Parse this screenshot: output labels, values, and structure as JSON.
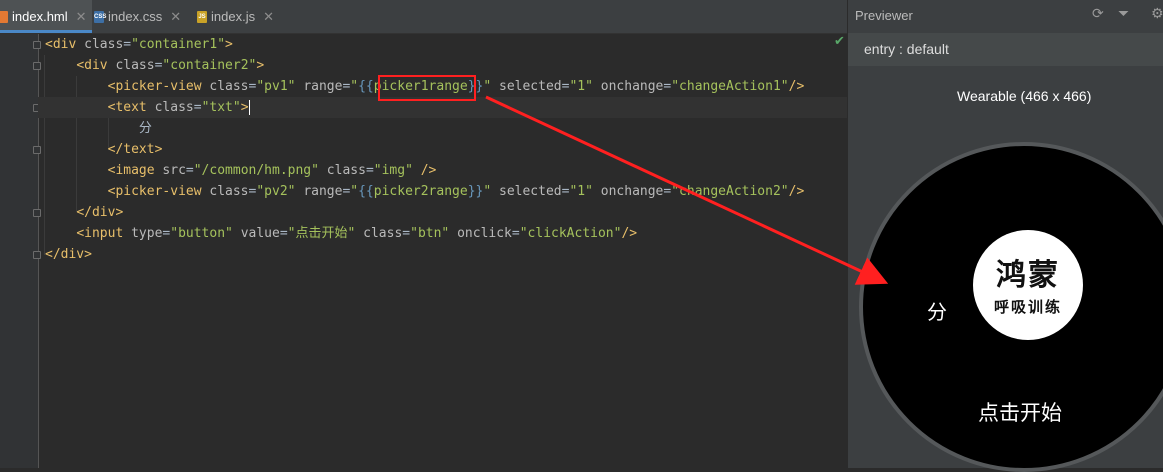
{
  "tabs": [
    {
      "label": "index.hml",
      "type": "html",
      "active": true
    },
    {
      "label": "index.css",
      "type": "css",
      "active": false
    },
    {
      "label": "index.js",
      "type": "js",
      "active": false
    }
  ],
  "tab_close_glyph": "✕",
  "editor": {
    "lines": [
      "<div class=\"container1\">",
      "<div class=\"container2\">",
      "<picker-view class=\"pv1\" range=\"{{picker1range}}\" selected=\"1\" onchange=\"changeAction1\"/>",
      "<text class=\"txt\">",
      "分",
      "</text>",
      "<image src=\"/common/hm.png\" class=\"img\" />",
      "<picker-view class=\"pv2\" range=\"{{picker2range}}\" selected=\"1\" onchange=\"changeAction2\"/>",
      "</div>",
      "<input type=\"button\" value=\"点击开始\" class=\"btn\" onclick=\"clickAction\"/>",
      "</div>"
    ],
    "status_icon": "check-icon"
  },
  "previewer": {
    "title": "Previewer",
    "entry": "entry : default",
    "device": "Wearable (466 x 466)",
    "screen": {
      "text": "分",
      "logo_title": "鸿蒙",
      "logo_subtitle": "呼吸训练",
      "button": "点击开始"
    }
  },
  "annotation": {
    "highlighted_token": "picker1range",
    "color": "#ff2020"
  },
  "colors": {
    "tag": "#e8bf6a",
    "attr": "#bababa",
    "string": "#a5c25c",
    "brace": "#6897bb",
    "accent": "#4a88c7"
  }
}
